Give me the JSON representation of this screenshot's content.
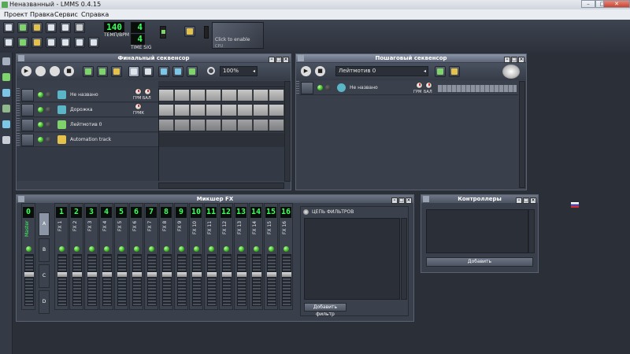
{
  "window": {
    "title": "Неназванный - LMMS 0.4.15",
    "minimize": "–",
    "maximize": "□",
    "close": "✕"
  },
  "menu": [
    "Проект",
    "Правка",
    "Сервис",
    "Справка"
  ],
  "toolbar": {
    "tempo_value": "140",
    "tempo_label": "ТЕМП/BPM",
    "sig_num": "4",
    "sig_den": "4",
    "sig_label": "TIME SIG",
    "cpu_hint": "Click to enable",
    "cpu_label": "CPU"
  },
  "song_editor": {
    "title": "Финальный секвенсор",
    "zoom": "100%",
    "tracks": [
      {
        "name": "Не названо",
        "icon": "instrument-icon",
        "knobs": [
          "ГРМ",
          "БАЛ"
        ]
      },
      {
        "name": "Дорожка",
        "icon": "sample-icon",
        "knobs": [
          "ГРМК"
        ]
      },
      {
        "name": "Лейтмотив 0",
        "icon": "beat-icon",
        "knobs": []
      },
      {
        "name": "Automation track",
        "icon": "folder-icon",
        "knobs": []
      }
    ]
  },
  "beat_editor": {
    "title": "Пошаговый секвенсор",
    "selected": "Лейтмотив 0",
    "track": {
      "name": "Не названо",
      "knobs": [
        "ГРМ",
        "БАЛ"
      ]
    }
  },
  "fx_mixer": {
    "title": "Микшер FX",
    "channels": [
      {
        "num": "0",
        "name": "Master"
      },
      {
        "num": "1",
        "name": "FX 1"
      },
      {
        "num": "2",
        "name": "FX 2"
      },
      {
        "num": "3",
        "name": "FX 3"
      },
      {
        "num": "4",
        "name": "FX 4"
      },
      {
        "num": "5",
        "name": "FX 5"
      },
      {
        "num": "6",
        "name": "FX 6"
      },
      {
        "num": "7",
        "name": "FX 7"
      },
      {
        "num": "8",
        "name": "FX 8"
      },
      {
        "num": "9",
        "name": "FX 9"
      },
      {
        "num": "10",
        "name": "FX 10"
      },
      {
        "num": "11",
        "name": "FX 11"
      },
      {
        "num": "12",
        "name": "FX 12"
      },
      {
        "num": "13",
        "name": "FX 13"
      },
      {
        "num": "14",
        "name": "FX 14"
      },
      {
        "num": "15",
        "name": "FX 15"
      },
      {
        "num": "16",
        "name": "FX 16"
      }
    ],
    "banks": [
      "A",
      "B",
      "C",
      "D"
    ],
    "effects_chain_label": "ЦЕПЬ ФИЛЬТРОВ",
    "add_effect": "Добавить фильтр"
  },
  "controllers": {
    "title": "Контроллеры",
    "add": "Добавить"
  },
  "colors": {
    "lcd_green": "#3bff5c",
    "panel": "#3a404b",
    "title_bar": "#5d6577"
  }
}
